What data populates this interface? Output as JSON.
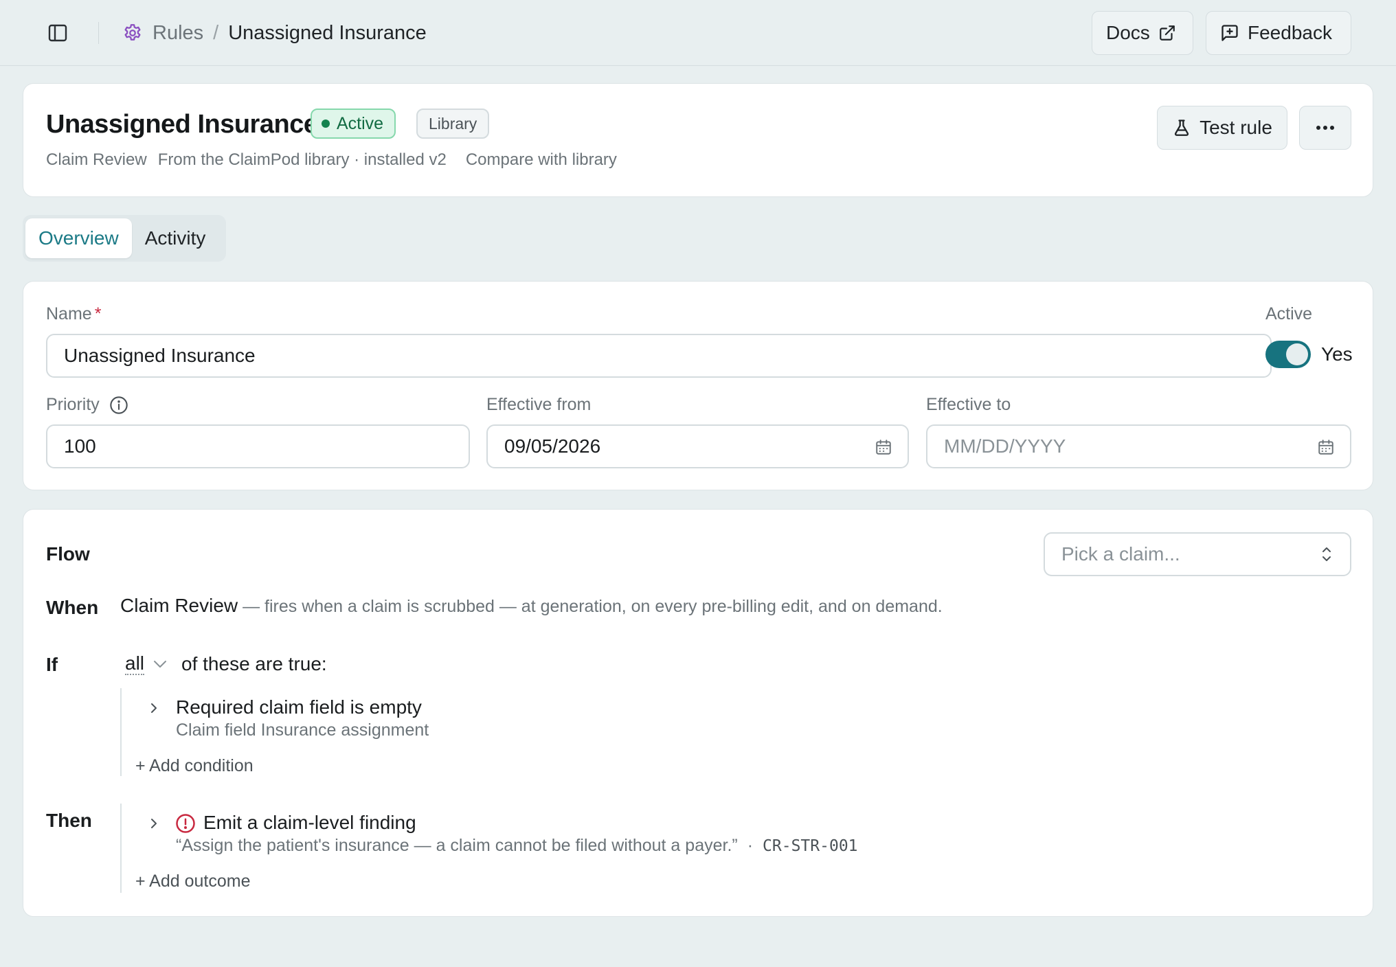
{
  "breadcrumb": {
    "parent": "Rules",
    "separator": "/",
    "current": "Unassigned Insurance"
  },
  "top_actions": {
    "docs_label": "Docs",
    "feedback_label": "Feedback"
  },
  "header": {
    "title": "Unassigned Insurance",
    "status_badge": "Active",
    "source_badge": "Library",
    "category": "Claim Review",
    "source_info": "From the ClaimPod library · installed v2",
    "compare_link": "Compare with library",
    "test_rule_label": "Test rule"
  },
  "tabs": [
    {
      "label": "Overview",
      "active": true
    },
    {
      "label": "Activity",
      "active": false
    }
  ],
  "form": {
    "name_label": "Name",
    "required_marker": "*",
    "name_value": "Unassigned Insurance",
    "active_label": "Active",
    "active_value": "Yes",
    "priority_label": "Priority",
    "priority_value": "100",
    "effective_from_label": "Effective from",
    "effective_from_value": "09/05/2026",
    "effective_to_label": "Effective to",
    "effective_to_placeholder": "MM/DD/YYYY"
  },
  "flow": {
    "title": "Flow",
    "claim_picker_placeholder": "Pick a claim...",
    "when_keyword": "When",
    "trigger_name": "Claim Review",
    "trigger_description": " — fires when a claim is scrubbed — at generation, on every pre-billing edit, and on demand.",
    "if_keyword": "If",
    "quantifier": "all",
    "if_suffix": "of these are true:",
    "conditions": [
      {
        "title": "Required claim field is empty",
        "detail": "Claim field Insurance assignment"
      }
    ],
    "add_condition_label": "+ Add condition",
    "then_keyword": "Then",
    "outcomes": [
      {
        "title": "Emit a claim-level finding",
        "message": "“Assign the patient's insurance — a claim cannot be filed without a payer.”",
        "separator": "·",
        "code": "CR-STR-001"
      }
    ],
    "add_outcome_label": "+ Add outcome"
  },
  "colors": {
    "accent": "#17737f",
    "active_badge_bg": "#dff6ea",
    "active_badge_text": "#126b43",
    "required": "#c8283f",
    "finding_icon": "#c8283f",
    "gear_icon": "#8a4fc0"
  },
  "icons": {
    "sidebar_toggle": "sidebar-toggle-icon",
    "breadcrumb": "gear-icon",
    "docs": "external-link-icon",
    "feedback": "message-plus-icon",
    "test_rule": "flask-icon",
    "more": "ellipsis-icon",
    "priority_info": "info-icon",
    "date": "calendar-icon",
    "claim_picker": "chevron-up-down-icon",
    "expand": "chevron-right-icon",
    "finding": "alert-circle-icon"
  }
}
